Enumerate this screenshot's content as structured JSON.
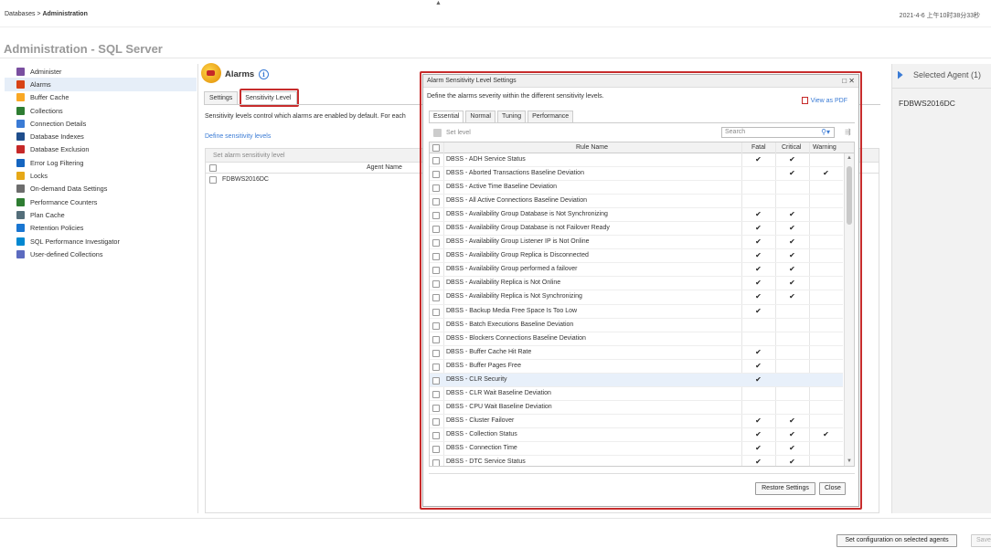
{
  "topbar": {
    "breadcrumb_root": "Databases",
    "breadcrumb_sep": ">",
    "breadcrumb_current": "Administration",
    "timestamp": "2021-4-6 上午10时38分33秒"
  },
  "page_title": "Administration - SQL Server",
  "sidebar": {
    "items": [
      {
        "label": "Administer",
        "icon": "administer-icon",
        "color": "#7a4fa0"
      },
      {
        "label": "Alarms",
        "icon": "alarms-icon",
        "color": "#d84315",
        "active": true
      },
      {
        "label": "Buffer Cache",
        "icon": "buffer-cache-icon",
        "color": "#f9a825"
      },
      {
        "label": "Collections",
        "icon": "collections-icon",
        "color": "#2e7d32"
      },
      {
        "label": "Connection Details",
        "icon": "connection-details-icon",
        "color": "#3a7bd5"
      },
      {
        "label": "Database Indexes",
        "icon": "database-indexes-icon",
        "color": "#1f4e8c"
      },
      {
        "label": "Database Exclusion",
        "icon": "database-exclusion-icon",
        "color": "#c62828"
      },
      {
        "label": "Error Log Filtering",
        "icon": "error-log-filter-icon",
        "color": "#1565c0"
      },
      {
        "label": "Locks",
        "icon": "lock-icon",
        "color": "#e6a817"
      },
      {
        "label": "On-demand Data Settings",
        "icon": "on-demand-icon",
        "color": "#6d6d6d"
      },
      {
        "label": "Performance Counters",
        "icon": "performance-counters-icon",
        "color": "#2e7d32"
      },
      {
        "label": "Plan Cache",
        "icon": "plan-cache-icon",
        "color": "#546e7a"
      },
      {
        "label": "Retention Policies",
        "icon": "retention-icon",
        "color": "#1976d2"
      },
      {
        "label": "SQL Performance Investigator",
        "icon": "investigator-icon",
        "color": "#0288d1"
      },
      {
        "label": "User-defined Collections",
        "icon": "user-collections-icon",
        "color": "#5c6bc0"
      }
    ]
  },
  "main": {
    "title": "Alarms",
    "tabs": [
      "Settings",
      "Sensitivity Level"
    ],
    "active_tab": "Sensitivity Level",
    "description": "Sensitivity levels control which alarms are enabled by default. For each",
    "define_link": "Define sensitivity levels",
    "panel_header": "Set alarm sensitivity level",
    "column_agent": "Agent Name",
    "agents": [
      "FDBWS2016DC"
    ]
  },
  "right_panel": {
    "header": "Selected Agent (1)",
    "agent": "FDBWS2016DC"
  },
  "bottom": {
    "set_config_label": "Set configuration on selected agents",
    "save_label": "Save"
  },
  "modal": {
    "title": "Alarm Sensitivity Level Settings",
    "description": "Define the alarms severity within the different sensitivity levels.",
    "pdf_link": "View as PDF",
    "tabs": [
      "Essential",
      "Normal",
      "Tuning",
      "Performance"
    ],
    "active_tab": "Essential",
    "set_level_label": "Set level",
    "search_placeholder": "Search",
    "columns": {
      "rule": "Rule Name",
      "fatal": "Fatal",
      "critical": "Critical",
      "warning": "Warning"
    },
    "check_glyph": "✔",
    "rules": [
      {
        "name": "DBSS - ADH Service Status",
        "fatal": true,
        "critical": true,
        "warning": false
      },
      {
        "name": "DBSS - Aborted Transactions Baseline Deviation",
        "fatal": false,
        "critical": true,
        "warning": true
      },
      {
        "name": "DBSS - Active Time Baseline Deviation",
        "fatal": false,
        "critical": false,
        "warning": false
      },
      {
        "name": "DBSS - All Active Connections Baseline Deviation",
        "fatal": false,
        "critical": false,
        "warning": false
      },
      {
        "name": "DBSS - Availability Group Database is Not Synchronizing",
        "fatal": true,
        "critical": true,
        "warning": false
      },
      {
        "name": "DBSS - Availability Group Database is not Failover Ready",
        "fatal": true,
        "critical": true,
        "warning": false
      },
      {
        "name": "DBSS - Availability Group Listener IP is Not Online",
        "fatal": true,
        "critical": true,
        "warning": false
      },
      {
        "name": "DBSS - Availability Group Replica is Disconnected",
        "fatal": true,
        "critical": true,
        "warning": false
      },
      {
        "name": "DBSS - Availability Group performed a failover",
        "fatal": true,
        "critical": true,
        "warning": false
      },
      {
        "name": "DBSS - Availability Replica is Not Online",
        "fatal": true,
        "critical": true,
        "warning": false
      },
      {
        "name": "DBSS - Availability Replica is Not Synchronizing",
        "fatal": true,
        "critical": true,
        "warning": false
      },
      {
        "name": "DBSS - Backup Media Free Space Is Too Low",
        "fatal": true,
        "critical": false,
        "warning": false
      },
      {
        "name": "DBSS - Batch Executions Baseline Deviation",
        "fatal": false,
        "critical": false,
        "warning": false
      },
      {
        "name": "DBSS - Blockers Connections Baseline Deviation",
        "fatal": false,
        "critical": false,
        "warning": false
      },
      {
        "name": "DBSS - Buffer Cache Hit Rate",
        "fatal": true,
        "critical": false,
        "warning": false
      },
      {
        "name": "DBSS - Buffer Pages Free",
        "fatal": true,
        "critical": false,
        "warning": false
      },
      {
        "name": "DBSS - CLR Security",
        "fatal": true,
        "critical": false,
        "warning": false,
        "selected": true
      },
      {
        "name": "DBSS - CLR Wait Baseline Deviation",
        "fatal": false,
        "critical": false,
        "warning": false
      },
      {
        "name": "DBSS - CPU Wait Baseline Deviation",
        "fatal": false,
        "critical": false,
        "warning": false
      },
      {
        "name": "DBSS - Cluster Failover",
        "fatal": true,
        "critical": true,
        "warning": false
      },
      {
        "name": "DBSS - Collection Status",
        "fatal": true,
        "critical": true,
        "warning": true
      },
      {
        "name": "DBSS - Connection Time",
        "fatal": true,
        "critical": true,
        "warning": false
      },
      {
        "name": "DBSS - DTC Service Status",
        "fatal": true,
        "critical": true,
        "warning": false
      }
    ],
    "restore_label": "Restore Settings",
    "close_label": "Close"
  }
}
